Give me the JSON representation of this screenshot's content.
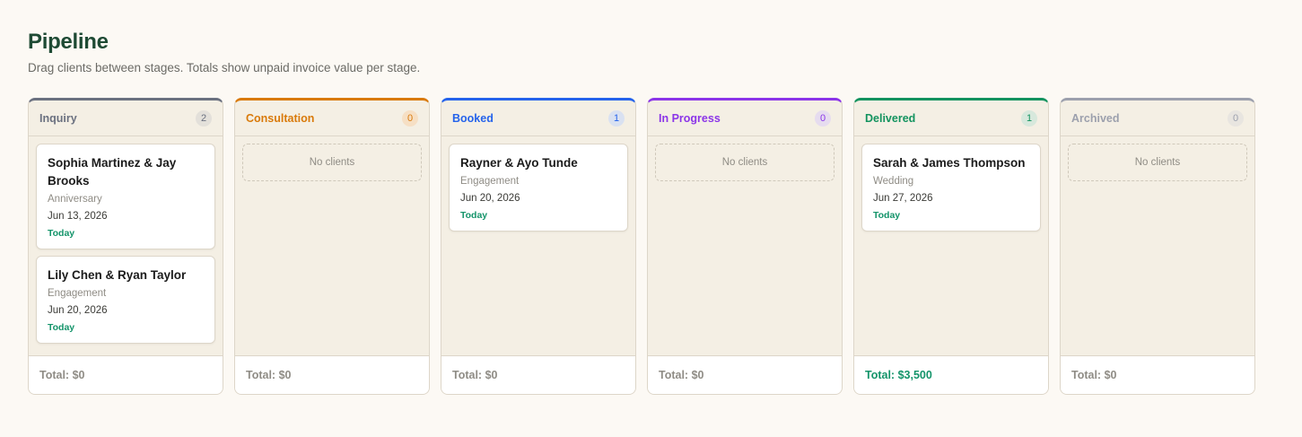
{
  "header": {
    "title": "Pipeline",
    "subtitle": "Drag clients between stages. Totals show unpaid invoice value per stage."
  },
  "columns": [
    {
      "name": "Inquiry",
      "count": "2",
      "accent": "#6b7180",
      "badge_bg": "#e3e0da",
      "badge_fg": "#6b7180",
      "total": "Total: $0",
      "empty_label": "",
      "cards": [
        {
          "name": "Sophia Martinez & Jay Brooks",
          "type": "Anniversary",
          "date": "Jun 13, 2026",
          "status": "Today"
        },
        {
          "name": "Lily Chen & Ryan Taylor",
          "type": "Engagement",
          "date": "Jun 20, 2026",
          "status": "Today"
        }
      ]
    },
    {
      "name": "Consultation",
      "count": "0",
      "accent": "#d97a0b",
      "badge_bg": "#f6dfc4",
      "badge_fg": "#d97a0b",
      "total": "Total: $0",
      "empty_label": "No clients",
      "cards": []
    },
    {
      "name": "Booked",
      "count": "1",
      "accent": "#2563eb",
      "badge_bg": "#d9e1f1",
      "badge_fg": "#2563eb",
      "total": "Total: $0",
      "empty_label": "",
      "cards": [
        {
          "name": "Rayner & Ayo Tunde",
          "type": "Engagement",
          "date": "Jun 20, 2026",
          "status": "Today"
        }
      ]
    },
    {
      "name": "In Progress",
      "count": "0",
      "accent": "#8b35e8",
      "badge_bg": "#e6dcef",
      "badge_fg": "#8b35e8",
      "total": "Total: $0",
      "empty_label": "No clients",
      "cards": []
    },
    {
      "name": "Delivered",
      "count": "1",
      "accent": "#13935f",
      "badge_bg": "#d7e8dc",
      "badge_fg": "#13935f",
      "total": "Total: $3,500",
      "empty_label": "",
      "cards": [
        {
          "name": "Sarah & James Thompson",
          "type": "Wedding",
          "date": "Jun 27, 2026",
          "status": "Today"
        }
      ]
    },
    {
      "name": "Archived",
      "count": "0",
      "accent": "#9ca0ad",
      "badge_bg": "#e8e5e0",
      "badge_fg": "#9ca0ad",
      "total": "Total: $0",
      "empty_label": "No clients",
      "cards": []
    }
  ]
}
